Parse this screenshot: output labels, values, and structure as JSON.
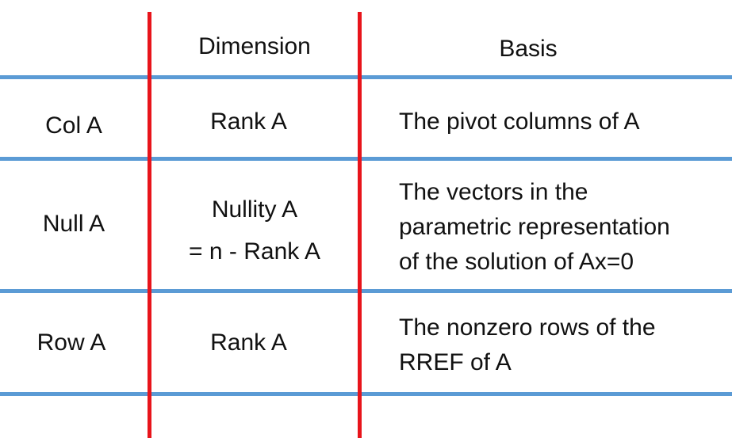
{
  "header": {
    "row_label": "",
    "dimension": "Dimension",
    "basis": "Basis"
  },
  "rows": [
    {
      "label": "Col A",
      "dimension": [
        "Rank A"
      ],
      "basis": [
        "The pivot columns of A"
      ]
    },
    {
      "label": "Null A",
      "dimension": [
        "Nullity A",
        "= n - Rank A"
      ],
      "basis": [
        "The vectors in the",
        "parametric representation",
        "of the solution of Ax=0"
      ]
    },
    {
      "label": "Row A",
      "dimension": [
        "Rank A"
      ],
      "basis": [
        "The nonzero rows of the",
        "RREF of A"
      ]
    }
  ],
  "colors": {
    "row_divider": "#5b9bd5",
    "column_divider": "#e8141b"
  }
}
